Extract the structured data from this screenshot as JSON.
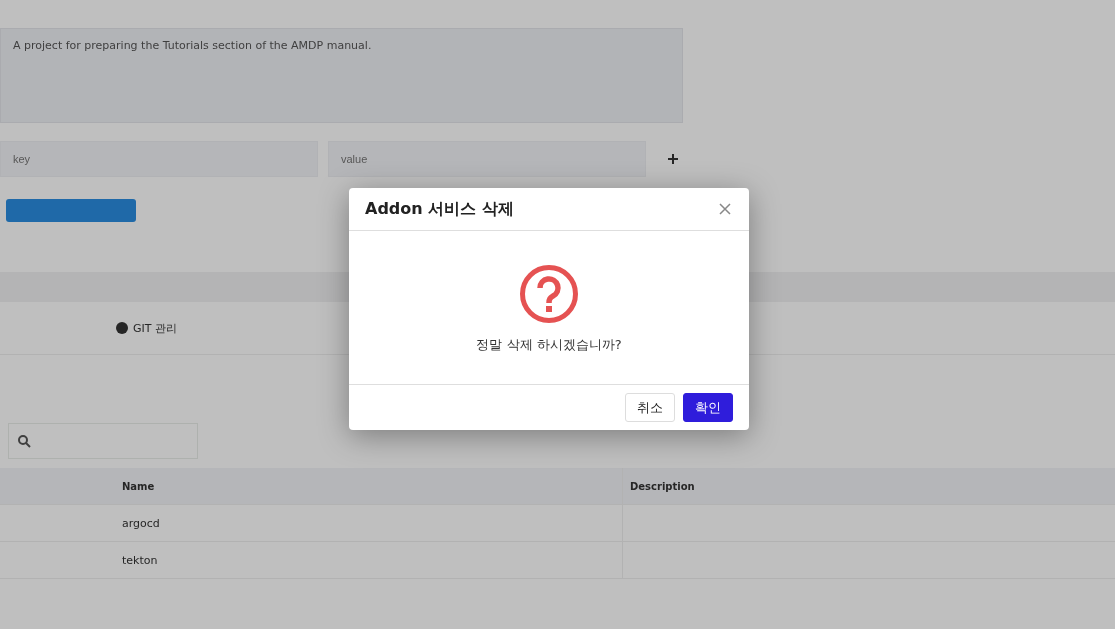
{
  "background": {
    "description": "A project for preparing the Tutorials section of the AMDP manual.",
    "key_field": {
      "placeholder": "key"
    },
    "value_field": {
      "placeholder": "value"
    },
    "tabs": [
      {
        "label": "GIT 관리",
        "selected": false
      }
    ],
    "table": {
      "columns": [
        "Name",
        "Description"
      ],
      "rows": [
        [
          "argocd",
          ""
        ],
        [
          "tekton",
          ""
        ]
      ]
    }
  },
  "dialog": {
    "title": "Addon 서비스 삭제",
    "message": "정말 삭제 하시겠습니까?",
    "buttons": [
      {
        "label": "취소",
        "kind": "secondary"
      },
      {
        "label": "확인",
        "kind": "primary"
      }
    ]
  }
}
